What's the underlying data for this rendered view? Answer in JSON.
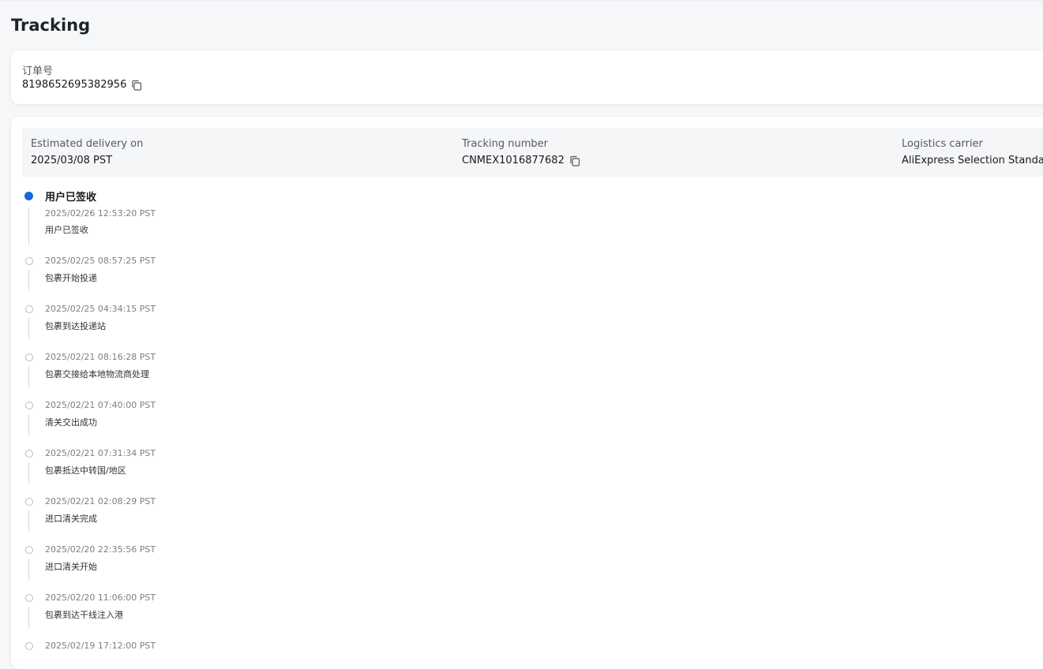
{
  "page": {
    "title": "Tracking"
  },
  "order": {
    "label": "订单号",
    "number": "8198652695382956"
  },
  "delivery": {
    "estimated_label": "Estimated delivery on",
    "estimated_value": "2025/03/08 PST",
    "tracking_label": "Tracking number",
    "tracking_value": "CNMEX1016877682",
    "carrier_label": "Logistics carrier",
    "carrier_value": "AliExpress Selection Standard"
  },
  "icons": {
    "copy": "copy-icon",
    "active_dot": "timeline-active-dot",
    "dot": "timeline-dot"
  },
  "colors": {
    "accent": "#1668dc",
    "background": "#f6f7f9"
  },
  "events": [
    {
      "title": "用户已签收",
      "time": "2025/02/26 12:53:20 PST",
      "desc": "用户已签收",
      "active": true
    },
    {
      "time": "2025/02/25 08:57:25 PST",
      "desc": "包裹开始投递"
    },
    {
      "time": "2025/02/25 04:34:15 PST",
      "desc": "包裹到达投递站"
    },
    {
      "time": "2025/02/21 08:16:28 PST",
      "desc": "包裹交接给本地物流商处理"
    },
    {
      "time": "2025/02/21 07:40:00 PST",
      "desc": "清关交出成功"
    },
    {
      "time": "2025/02/21 07:31:34 PST",
      "desc": "包裹抵达中转国/地区"
    },
    {
      "time": "2025/02/21 02:08:29 PST",
      "desc": "进口清关完成"
    },
    {
      "time": "2025/02/20 22:35:56 PST",
      "desc": "进口清关开始"
    },
    {
      "time": "2025/02/20 11:06:00 PST",
      "desc": "包裹到达干线注入港"
    },
    {
      "time": "2025/02/19 17:12:00 PST",
      "desc": ""
    }
  ]
}
